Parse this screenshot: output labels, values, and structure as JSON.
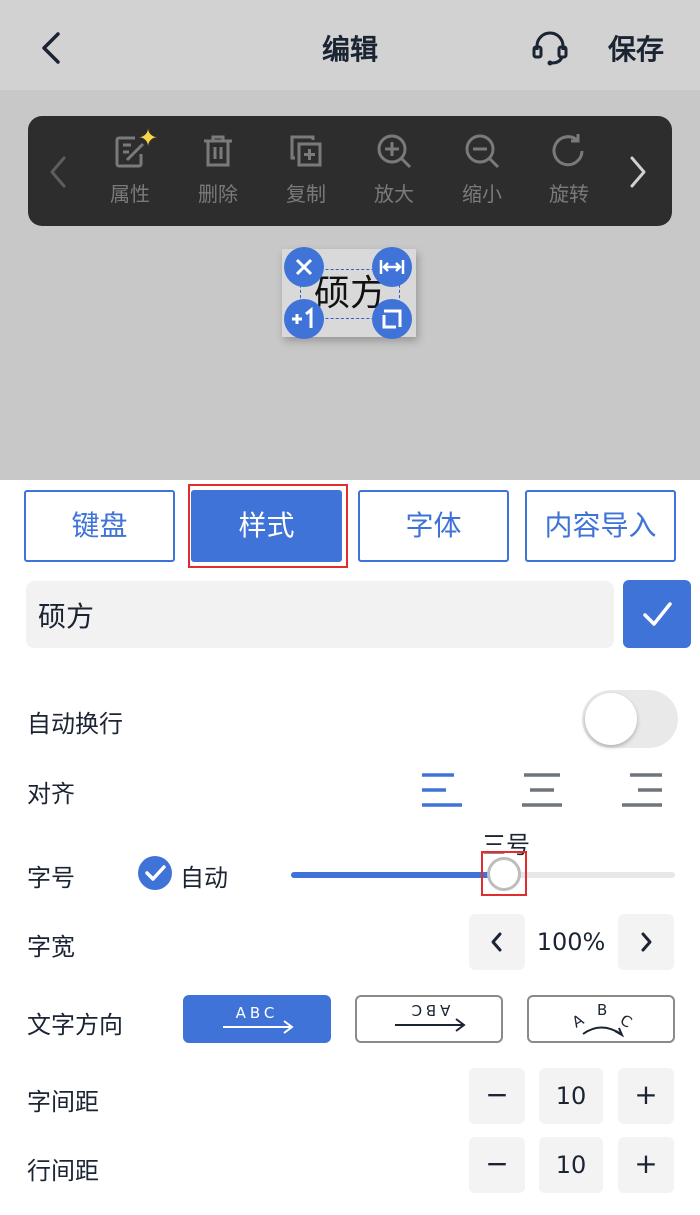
{
  "header": {
    "title": "编辑",
    "save_label": "保存",
    "back_icon": "chevron-left-icon",
    "support_icon": "headset-icon"
  },
  "toolbar": {
    "items": [
      {
        "label": "属性",
        "icon": "edit-properties-icon"
      },
      {
        "label": "删除",
        "icon": "trash-icon"
      },
      {
        "label": "复制",
        "icon": "copy-icon"
      },
      {
        "label": "放大",
        "icon": "zoom-in-icon"
      },
      {
        "label": "缩小",
        "icon": "zoom-out-icon"
      },
      {
        "label": "旋转",
        "icon": "rotate-icon"
      }
    ]
  },
  "canvas": {
    "label_text": "硕方"
  },
  "tabs": [
    {
      "label": "键盘",
      "active": false
    },
    {
      "label": "样式",
      "active": true
    },
    {
      "label": "字体",
      "active": false
    },
    {
      "label": "内容导入",
      "active": false
    }
  ],
  "text_input": {
    "value": "硕方"
  },
  "settings": {
    "auto_wrap": {
      "label": "自动换行",
      "enabled": false
    },
    "align": {
      "label": "对齐",
      "options": [
        "left",
        "center",
        "right"
      ],
      "selected": "left"
    },
    "font_size": {
      "label": "字号",
      "auto_label": "自动",
      "auto_checked": true,
      "value_label": "三号",
      "slider_fraction": 0.55
    },
    "font_width": {
      "label": "字宽",
      "value": "100%"
    },
    "text_direction": {
      "label": "文字方向",
      "options": [
        "horizontal",
        "rotated",
        "arc"
      ],
      "selected": "horizontal",
      "glyphs": "ABC"
    },
    "letter_spacing": {
      "label": "字间距",
      "value": "10",
      "minus": "−",
      "plus": "+"
    },
    "line_spacing": {
      "label": "行间距",
      "value": "10",
      "minus": "−",
      "plus": "+"
    }
  },
  "colors": {
    "accent": "#3f73d8",
    "highlight": "#e02e2e",
    "toolbar_bg": "#2d2d2d",
    "canvas_bg": "#c8c8c8"
  }
}
